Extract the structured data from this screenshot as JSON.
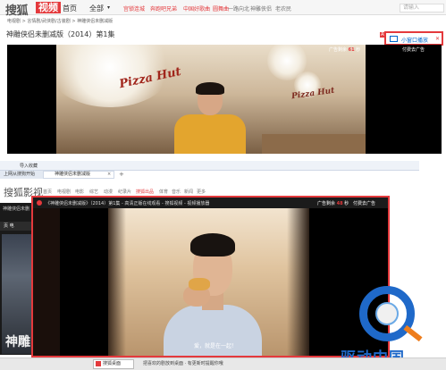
{
  "top": {
    "logo_text": "搜狐",
    "logo_badge": "视频",
    "nav": {
      "home": "首页",
      "all": "全部",
      "all_arrow": "▾"
    },
    "hot_links": [
      "宫锁连城",
      "奔跑吧兄弟",
      "中国好歌曲",
      "圆舞曲",
      "一路向北",
      "神雕侠侣",
      "老农民"
    ],
    "search_placeholder": "请输入",
    "breadcrumb": "电视剧 > 言情剧/武侠剧/古装剧 > 神雕侠侣未删减版",
    "video_title": "神雕侠侣未删减版（2014）第1集",
    "ad_badge": "AD",
    "mini_button_label": "小窗口播放",
    "mini_close": "✕",
    "player": {
      "ad_remaining_label": "广告剩余",
      "ad_remaining_seconds": "61",
      "ad_unit": "秒",
      "skip_label": "付费去广告",
      "sign_text": "Pizza Hut",
      "sign_text_2": "Pizza Hut"
    }
  },
  "bottom": {
    "import_favorites": "导入收藏",
    "tab_1": "上网从搜狗开始",
    "tab_2": "神雕侠侣未删减版",
    "tab_close": "×",
    "tab_add": "+",
    "site_title": "搜狐影视",
    "site_nav": [
      "首页",
      "电视剧",
      "电影",
      "综艺",
      "动漫",
      "纪录片",
      "搜狐出品",
      "体育",
      "音乐",
      "新闻",
      "更多"
    ],
    "side_tag": "神雕侠侣未删",
    "side_row": "页  电",
    "side_poster_text": "神雕",
    "mini_player": {
      "title": "《神雕侠侣未删减版》（2014）第1集 - 高清正版在线观看 - 搜狐视频 - 视频播放器",
      "ad_remaining_label": "广告剩余",
      "ad_remaining_seconds": "48",
      "ad_unit": "秒",
      "skip_label": "付费去广告",
      "subtitle": "爱，就是在一起！"
    },
    "taskbar": {
      "button_label": "搜狐桌面",
      "tip": "把喜欢的剧放到桌面 · 有更新时提醒你哦"
    },
    "watermark": "驱动中国"
  }
}
